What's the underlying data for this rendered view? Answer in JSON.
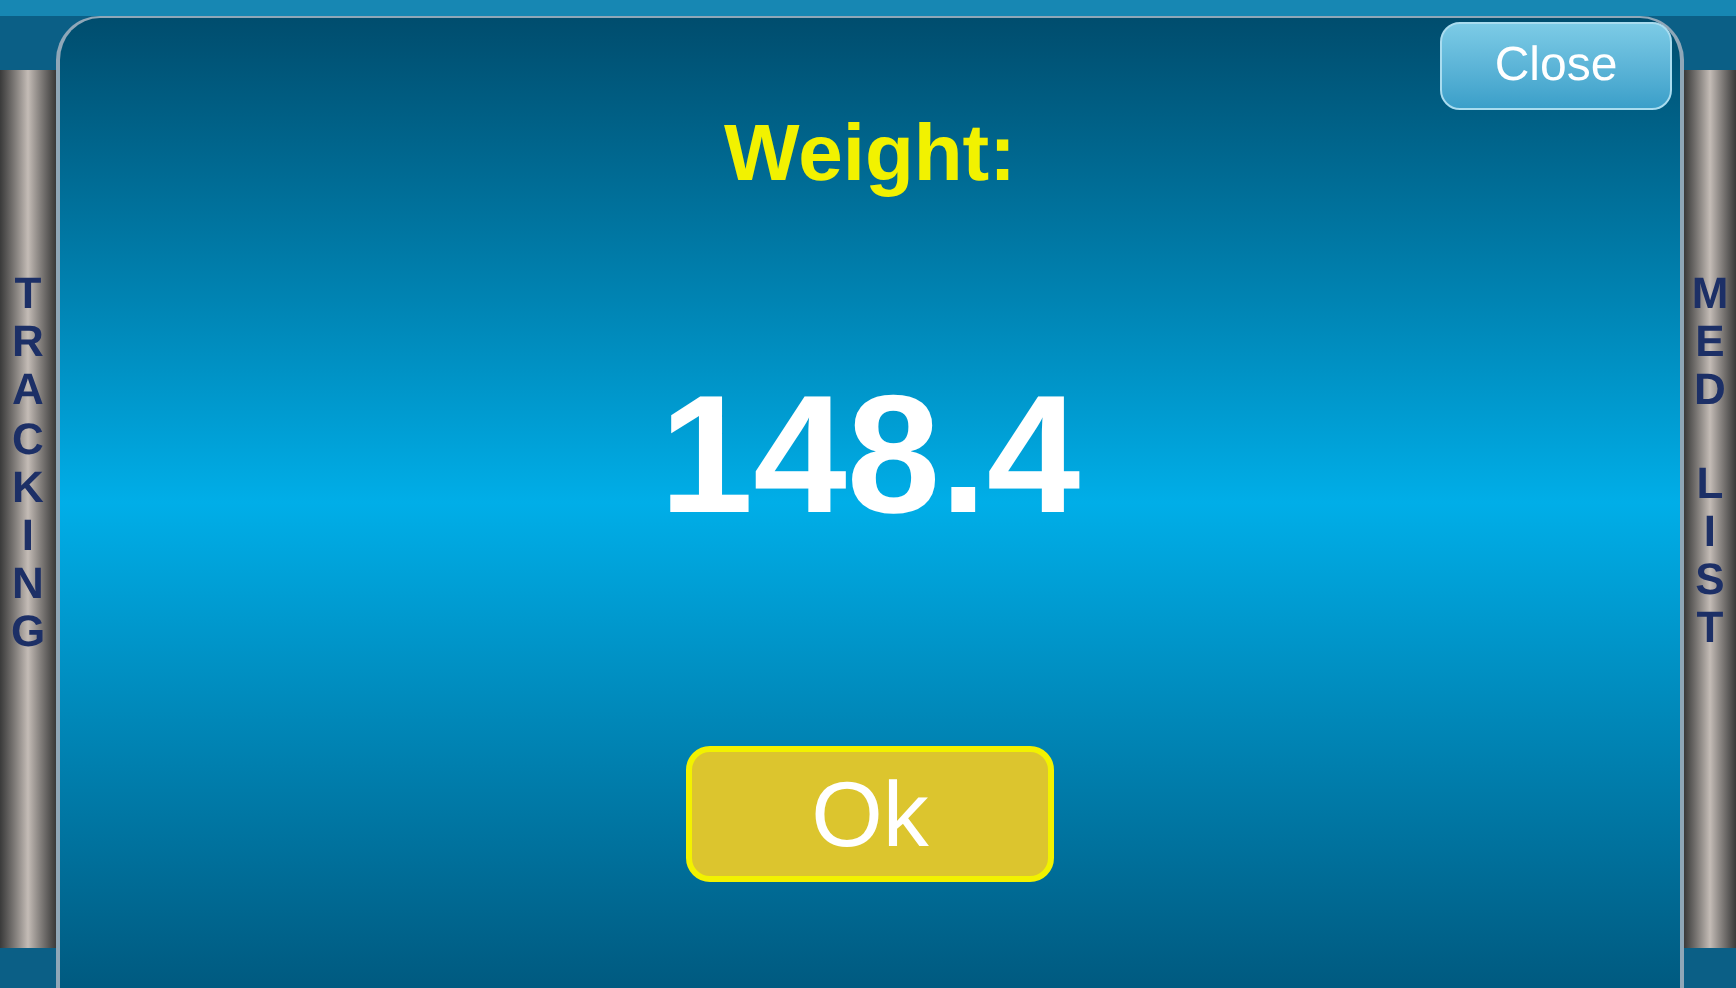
{
  "side_left": {
    "label": "TRACKING"
  },
  "side_right": {
    "labels": [
      "MED",
      "LIST"
    ]
  },
  "dialog": {
    "close_button": "Close",
    "title": "Weight:",
    "value": "148.4",
    "ok_button": "Ok"
  }
}
